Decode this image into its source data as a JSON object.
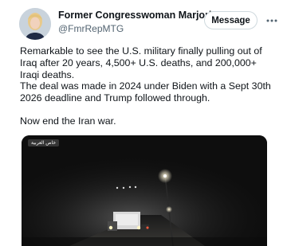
{
  "author": {
    "display_name": "Former Congresswoman Marjorie T...",
    "handle": "@FmrRepMTG",
    "verified": true
  },
  "actions": {
    "message_label": "Message"
  },
  "tweet": {
    "paragraphs": [
      "Remarkable to see the U.S. military finally pulling out of Iraq after 20 years, 4,500+ U.S. deaths, and 200,000+ Iraqi deaths.",
      "The deal was made in 2024 under Biden with a Sept 30th 2026 deadline and Trump followed through.",
      "Now end the Iran war."
    ]
  },
  "media": {
    "channel_tag": "خاص العربية"
  },
  "colors": {
    "verified_blue": "#1d9bf0",
    "secondary_text": "#536471",
    "button_border": "#cfd9de"
  }
}
